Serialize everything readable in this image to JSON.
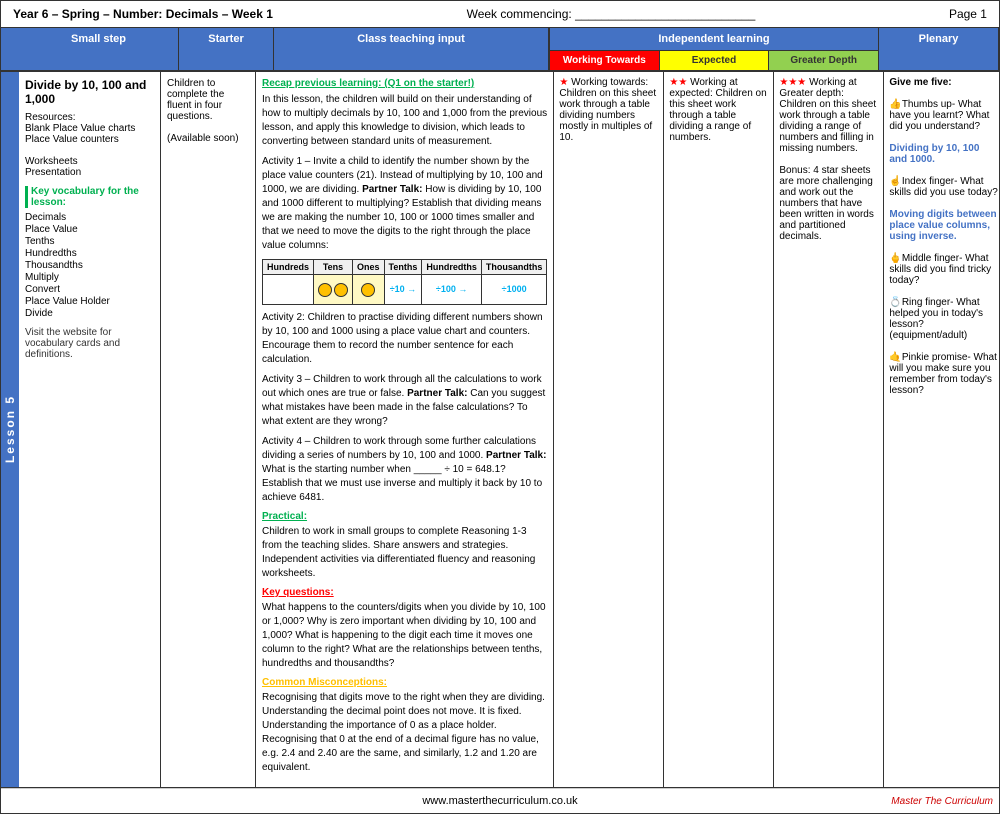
{
  "header": {
    "title": "Year 6 – Spring – Number: Decimals – Week 1",
    "week_commencing": "Week commencing: ___________________________",
    "page": "Page 1"
  },
  "col_headers": {
    "small_step": "Small step",
    "starter": "Starter",
    "teaching": "Class teaching input",
    "independent": "Independent learning",
    "plenary": "Plenary"
  },
  "independent_sub_headers": {
    "working": "Working Towards",
    "expected": "Expected",
    "greater": "Greater Depth"
  },
  "lesson_label": "Lesson 5",
  "small_step": {
    "title": "Divide by 10, 100 and 1,000",
    "resources_label": "Resources:",
    "resources": [
      "Blank Place Value charts",
      "Place Value counters",
      "",
      "Worksheets",
      "Presentation"
    ],
    "vocab_header": "Key vocabulary for the lesson:",
    "vocab_items": [
      "Decimals",
      "Place Value",
      "Tenths",
      "Hundredths",
      "Thousandths",
      "Multiply",
      "Convert",
      "Place Value Holder",
      "Divide"
    ],
    "visit_note": "Visit the website for vocabulary cards and definitions."
  },
  "starter": {
    "text": "Children to complete the fluent in four questions.",
    "available": "(Available soon)"
  },
  "teaching": {
    "recap_header": "Recap previous learning: (Q1 on the starter!)",
    "intro": "In this lesson, the children will build on their understanding of how to multiply decimals by 10, 100 and 1,000 from the previous lesson, and apply this knowledge to division, which leads to converting between standard units of measurement.",
    "activity1": "Activity 1 – Invite a child to identify the number shown by the place value counters (21). Instead of multiplying by 10, 100 and 1000, we are dividing.",
    "partner_talk1": "Partner Talk:",
    "activity1b": "How is dividing by 10, 100 and 1000 different to multiplying?  Establish that dividing means we are making the number 10, 100 or 1000 times smaller and that we need to move the digits to the right through the place value columns:",
    "pv_table_headers": [
      "Hundreds",
      "Tens",
      "Ones",
      "Tenths",
      "Hundredths",
      "Thousandths"
    ],
    "arrow1": "+10",
    "arrow2": "+100",
    "arrow3": "+1000",
    "activity2": "Activity 2: Children to practise dividing different numbers shown by 10, 100 and 1000 using a place value chart and counters. Encourage them to record the number sentence for each calculation.",
    "activity3": "Activity 3 – Children to work through all the calculations  to work out which ones are true or false.",
    "partner_talk2": "Partner Talk:",
    "activity3b": "Can you suggest what mistakes have been made in the false calculations?  To what extent are they wrong?",
    "activity4": "Activity 4 – Children to work through some further calculations dividing a series of numbers by 10, 100 and 1000.",
    "partner_talk3": "Partner Talk:",
    "activity4b": "What is the starting number when _____ ÷ 10 = 648.1? Establish that we must use inverse and multiply it back by 10 to achieve 6481.",
    "practical_header": "Practical:",
    "practical_text": "Children to work in small groups to complete Reasoning 1-3 from the teaching slides. Share answers and strategies. Independent activities via differentiated fluency and reasoning worksheets.",
    "key_q_header": "Key questions:",
    "key_q_text": "What happens to the counters/digits when you divide by 10, 100 or 1,000? Why is zero important when dividing by 10, 100 and 1,000? What is happening to the digit each time it moves one column to the right? What are the relationships between tenths, hundredths and thousandths?",
    "misconception_header": "Common Misconceptions:",
    "misconception_text": "Recognising that digits move to the right when they are dividing. Understanding the decimal point does not move. It is fixed. Understanding the importance of 0 as a place holder. Recognising that 0 at the end of a decimal figure has no value, e.g. 2.4 and 2.40 are the same, and similarly, 1.2 and 1.20 are equivalent."
  },
  "independent": {
    "working": {
      "stars": "★",
      "text": "Working towards: Children on this sheet work through a table dividing numbers mostly in multiples of 10."
    },
    "expected": {
      "stars": "★★",
      "text": "Working at expected: Children on this sheet work through a table dividing a range of numbers."
    },
    "greater": {
      "stars": "★★★",
      "text": "Working at Greater depth: Children on this sheet work through a table dividing a range of numbers and filling in missing numbers.",
      "bonus": "Bonus: 4 star sheets are more challenging and work out the numbers that have been written in words and partitioned decimals."
    }
  },
  "plenary": {
    "intro": "Give me five:",
    "thumb": "👍Thumbs up- What have you learnt? What did you understand?",
    "link1": "Dividing by 10, 100 and 1000.",
    "index": "☝️Index finger- What skills did you use today?",
    "link2": "Moving digits between place value columns, using inverse.",
    "middle": "🖕Middle finger- What skills did you find tricky today?",
    "ring": "💍Ring finger- What helped you in today's lesson? (equipment/adult)",
    "pinkie": "🤙Pinkie promise- What will you make sure you remember from today's lesson?"
  },
  "footer": {
    "website": "www.masterthecurriculum.co.uk",
    "logo": "Master The Curriculum"
  }
}
